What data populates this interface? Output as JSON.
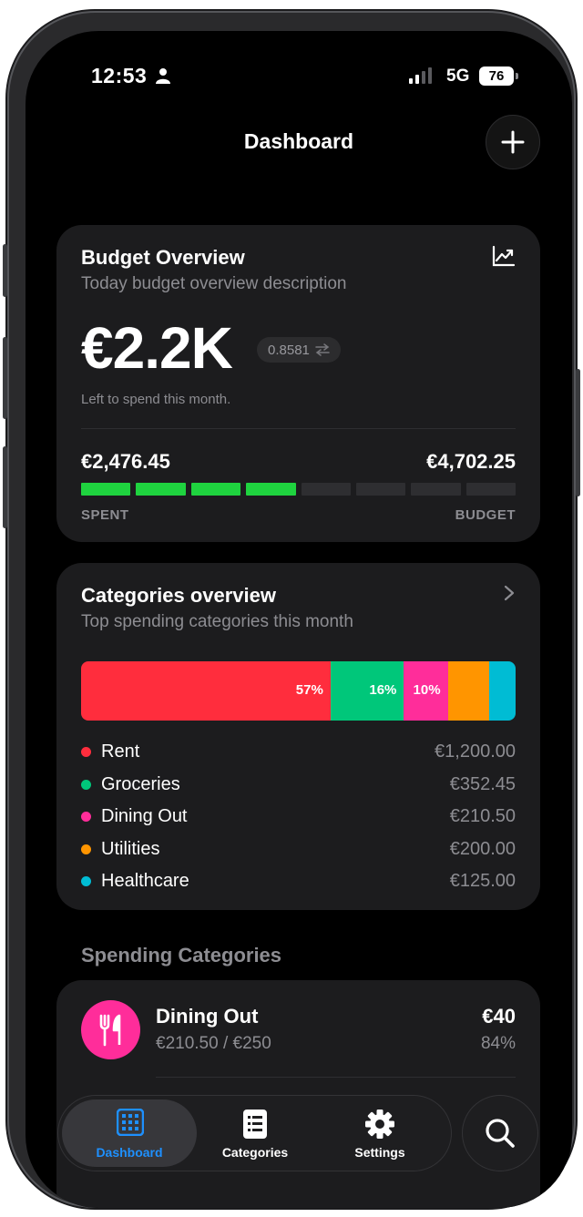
{
  "status": {
    "time": "12:53",
    "network": "5G",
    "battery": "76"
  },
  "header": {
    "title": "Dashboard"
  },
  "budget_overview": {
    "title": "Budget Overview",
    "subtitle": "Today budget overview description",
    "amount": "€2.2K",
    "rate": "0.8581",
    "left_label": "Left to spend this month.",
    "spent": "€2,476.45",
    "budget": "€4,702.25",
    "spent_caption": "SPENT",
    "budget_caption": "BUDGET",
    "segments_total": 8,
    "segments_filled": 4,
    "fill_color": "#1fd33f"
  },
  "categories_overview": {
    "title": "Categories overview",
    "subtitle": "Top spending categories this month",
    "items": [
      {
        "name": "Rent",
        "amount": "€1,200.00",
        "color": "#ff2d3d",
        "share": 57.4,
        "pct_label": "57%"
      },
      {
        "name": "Groceries",
        "amount": "€352.45",
        "color": "#00c77a",
        "share": 16.9,
        "pct_label": "16%"
      },
      {
        "name": "Dining Out",
        "amount": "€210.50",
        "color": "#ff2d9a",
        "share": 10.1,
        "pct_label": "10%"
      },
      {
        "name": "Utilities",
        "amount": "€200.00",
        "color": "#ff9500",
        "share": 9.6,
        "pct_label": ""
      },
      {
        "name": "Healthcare",
        "amount": "€125.00",
        "color": "#00bcd4",
        "share": 6.0,
        "pct_label": ""
      }
    ]
  },
  "spending": {
    "section_title": "Spending Categories",
    "first": {
      "name": "Dining Out",
      "progress": "€210.50 / €250",
      "remaining": "€40",
      "percent": "84%",
      "color": "#ff2d9a"
    }
  },
  "tabs": [
    {
      "label": "Dashboard",
      "icon": "dashboard-grid-icon",
      "active": true
    },
    {
      "label": "Categories",
      "icon": "list-icon",
      "active": false
    },
    {
      "label": "Settings",
      "icon": "gear-icon",
      "active": false
    }
  ],
  "accent_color": "#1e90ff"
}
